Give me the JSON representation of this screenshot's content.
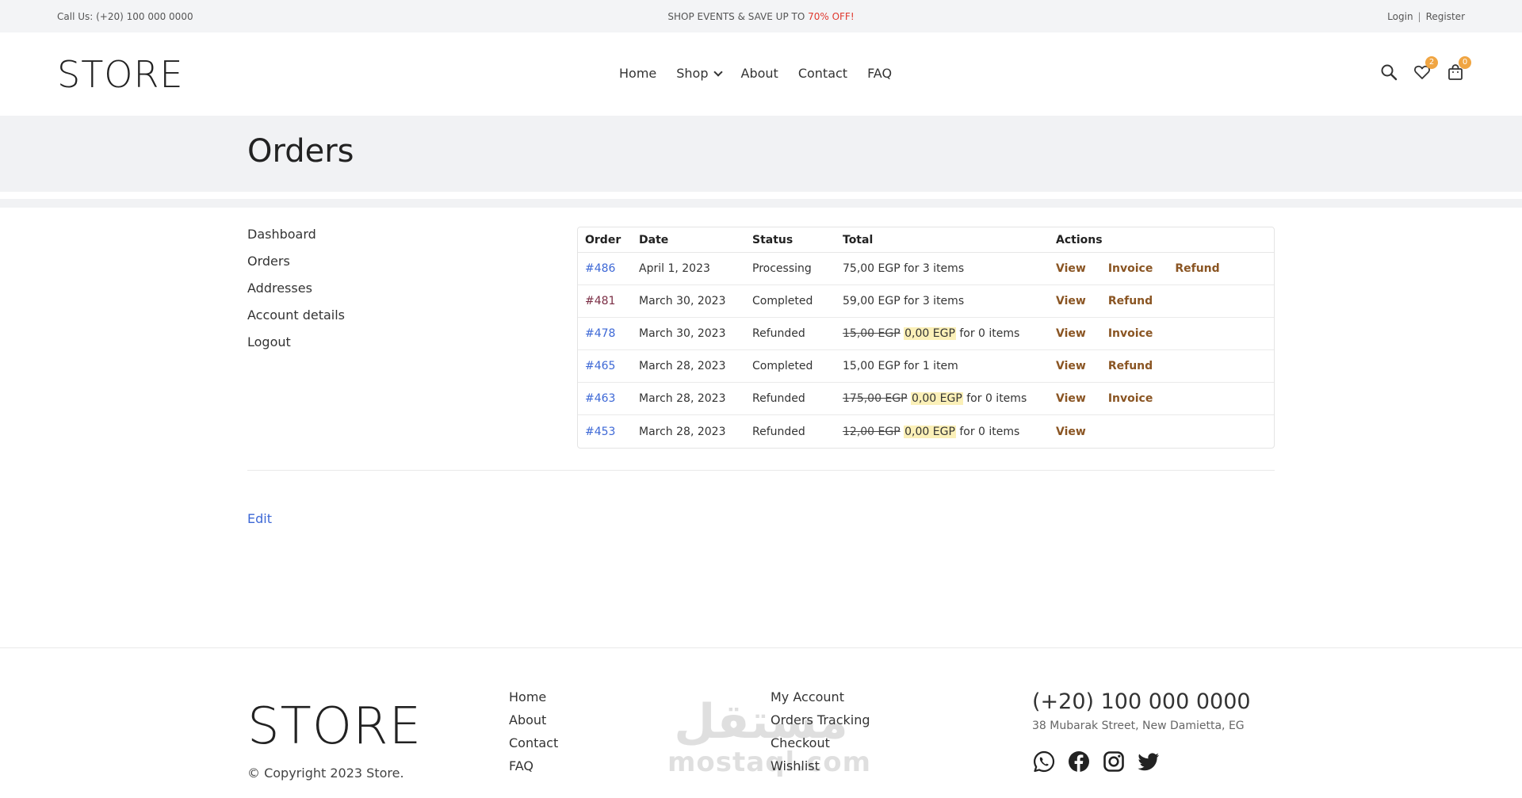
{
  "topbar": {
    "call": "Call Us: (+20) 100 000 0000",
    "promo_prefix": "SHOP EVENTS & SAVE UP TO ",
    "promo_highlight": "70% OFF!",
    "login": "Login",
    "separator": "|",
    "register": "Register"
  },
  "header": {
    "logo": "STORE",
    "nav": [
      "Home",
      "Shop",
      "About",
      "Contact",
      "FAQ"
    ],
    "wishlist_count": "2",
    "cart_count": "0"
  },
  "page": {
    "title": "Orders"
  },
  "account_nav": [
    "Dashboard",
    "Orders",
    "Addresses",
    "Account details",
    "Logout"
  ],
  "orders": {
    "columns": [
      "Order",
      "Date",
      "Status",
      "Total",
      "Actions"
    ],
    "rows": [
      {
        "order": "#486",
        "date": "April 1, 2023",
        "status": "Processing",
        "old_total": "",
        "total": "75,00 EGP",
        "items": "for 3 items",
        "actions": [
          "View",
          "Invoice",
          "Refund"
        ]
      },
      {
        "order": "#481",
        "date": "March 30, 2023",
        "status": "Completed",
        "old_total": "",
        "total": "59,00 EGP",
        "items": "for 3 items",
        "actions": [
          "View",
          "Refund"
        ]
      },
      {
        "order": "#478",
        "date": "March 30, 2023",
        "status": "Refunded",
        "old_total": "15,00 EGP",
        "total": "0,00 EGP",
        "items": "for 0 items",
        "actions": [
          "View",
          "Invoice"
        ]
      },
      {
        "order": "#465",
        "date": "March 28, 2023",
        "status": "Completed",
        "old_total": "",
        "total": "15,00 EGP",
        "items": "for 1 item",
        "actions": [
          "View",
          "Refund"
        ]
      },
      {
        "order": "#463",
        "date": "March 28, 2023",
        "status": "Refunded",
        "old_total": "175,00 EGP",
        "total": "0,00 EGP",
        "items": "for 0 items",
        "actions": [
          "View",
          "Invoice"
        ]
      },
      {
        "order": "#453",
        "date": "March 28, 2023",
        "status": "Refunded",
        "old_total": "12,00 EGP",
        "total": "0,00 EGP",
        "items": "for 0 items",
        "actions": [
          "View"
        ]
      }
    ]
  },
  "edit_link": "Edit",
  "footer": {
    "logo": "STORE",
    "copyright": "© Copyright 2023 Store.",
    "links_col1": [
      "Home",
      "About",
      "Contact",
      "FAQ"
    ],
    "links_col2": [
      "My Account",
      "Orders Tracking",
      "Checkout",
      "Wishlist"
    ],
    "phone": "(+20) 100 000 0000",
    "address": "38 Mubarak Street, New Damietta, EG",
    "social": [
      "whatsapp-icon",
      "facebook-icon",
      "instagram-icon",
      "twitter-icon"
    ]
  },
  "watermark": {
    "arabic": "مستقل",
    "latin": "mostaql.com"
  },
  "colors": {
    "accent": "#f0a542",
    "link": "#3d68d6",
    "action": "#8a5523",
    "promo": "#e0382e",
    "band": "#f1f2f4"
  }
}
